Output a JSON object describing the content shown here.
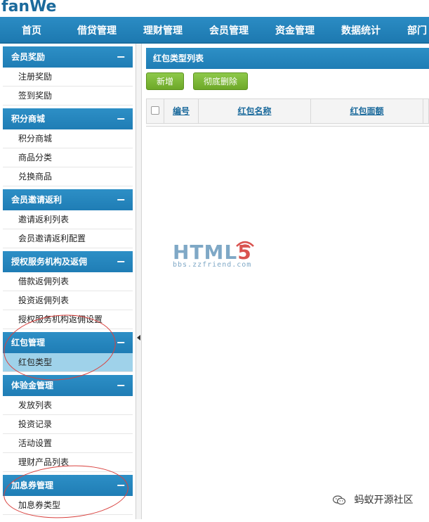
{
  "brand": {
    "logo_text": "fanWe"
  },
  "nav": {
    "items": [
      "首页",
      "借贷管理",
      "理财管理",
      "会员管理",
      "资金管理",
      "数据统计",
      "部门"
    ]
  },
  "sidebar": {
    "groups": [
      {
        "title": "会员奖励",
        "items": [
          "注册奖励",
          "签到奖励"
        ]
      },
      {
        "title": "积分商城",
        "items": [
          "积分商城",
          "商品分类",
          "兑换商品"
        ]
      },
      {
        "title": "会员邀请返利",
        "items": [
          "邀请返利列表",
          "会员邀请返利配置"
        ]
      },
      {
        "title": "授权服务机构及返佣",
        "items": [
          "借款返佣列表",
          "投资返佣列表",
          "授权服务机构返佣设置"
        ]
      },
      {
        "title": "红包管理",
        "items": [
          "红包类型"
        ]
      },
      {
        "title": "体验金管理",
        "items": [
          "发放列表",
          "投资记录",
          "活动设置",
          "理财产品列表"
        ]
      },
      {
        "title": "加息券管理",
        "items": [
          "加息券类型"
        ]
      }
    ],
    "collapse_symbol": "−",
    "active_item": "红包类型"
  },
  "main": {
    "panel_title": "红包类型列表",
    "buttons": {
      "add": "新增",
      "delete": "彻底删除"
    },
    "table": {
      "columns": [
        "编号",
        "红包名称",
        "红包面额"
      ]
    }
  },
  "watermark": {
    "text": "HTML",
    "digit": "5",
    "sub": "bbs.zzfriend.com"
  },
  "footer": {
    "wechat_label": "蚂蚁开源社区"
  },
  "colors": {
    "nav_blue": "#1d79b0",
    "green_button": "#6da828",
    "active_item": "#9fd2ea",
    "annotation_red": "#d9423f"
  }
}
